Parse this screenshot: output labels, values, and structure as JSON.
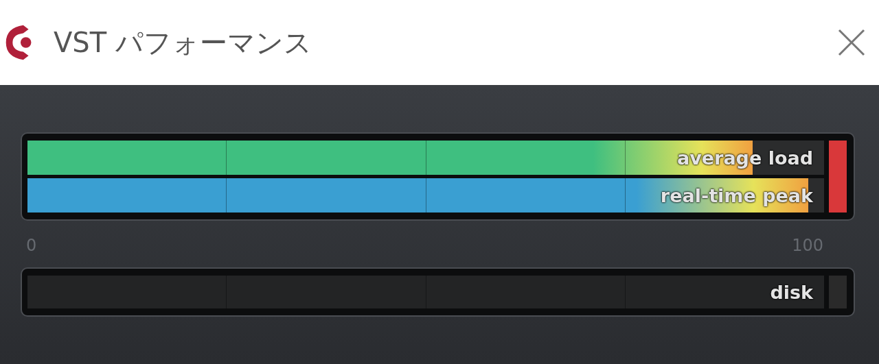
{
  "window": {
    "title": "VST パフォーマンス"
  },
  "cpu": {
    "meters": [
      {
        "label": "average load",
        "level": 0.91,
        "color": "#3fbf80"
      },
      {
        "label": "real-time peak",
        "level": 0.98,
        "color": "#3a9fd2"
      }
    ],
    "overload": true
  },
  "scale": {
    "min": "0",
    "max": "100"
  },
  "disk": {
    "label": "disk",
    "overload": false
  }
}
